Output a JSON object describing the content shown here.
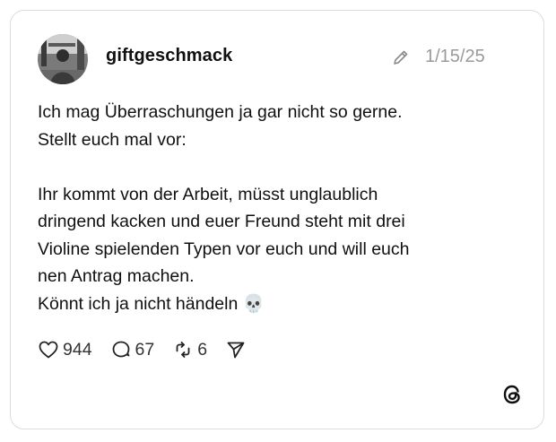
{
  "post": {
    "username": "giftgeschmack",
    "date": "1/15/25",
    "text": "Ich mag Überraschungen ja gar nicht so gerne.\nStellt euch mal vor:\n\nIhr kommt von der Arbeit, müsst unglaublich\ndringend kacken und euer Freund steht mit drei\nVioline spielenden Typen vor euch und will euch\nnen Antrag machen.\nKönnt ich ja nicht händeln 💀"
  },
  "actions": {
    "likes": "944",
    "replies": "67",
    "reposts": "6"
  },
  "icons": {
    "edited": "pencil-icon",
    "like": "heart-icon",
    "reply": "speech-bubble-icon",
    "repost": "repost-icon",
    "share": "send-icon",
    "brand": "threads-logo-icon"
  },
  "colors": {
    "text": "#101010",
    "muted": "#9a9a9a",
    "border": "#dcdcdc"
  }
}
